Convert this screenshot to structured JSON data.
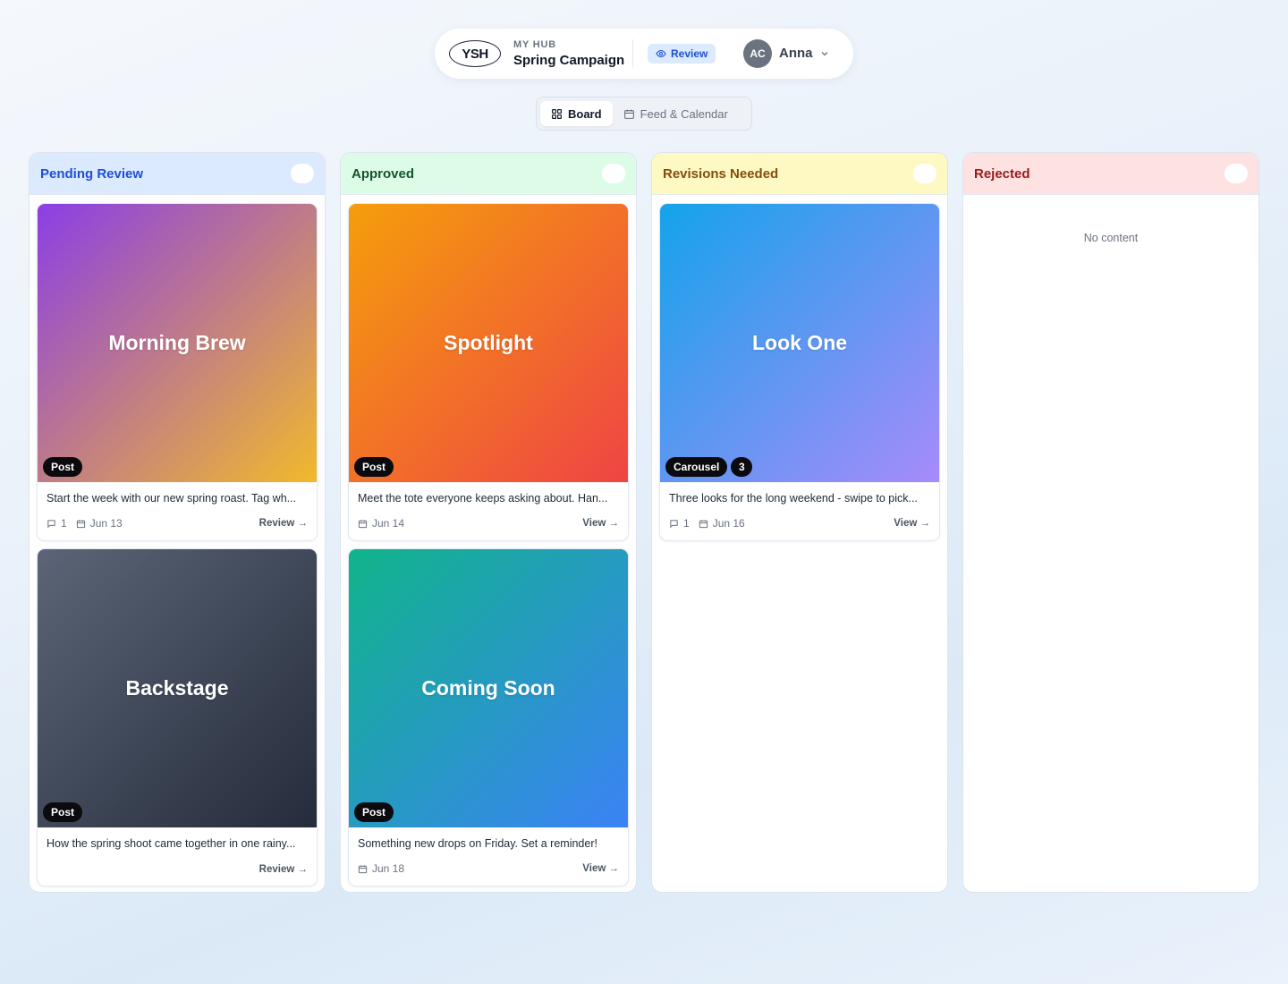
{
  "header": {
    "logo_text": "YSH",
    "hub_label": "MY HUB",
    "campaign_title": "Spring Campaign",
    "mode_badge": "Review",
    "user_initials": "AC",
    "user_name": "Anna"
  },
  "view_toggle": {
    "board_label": "Board",
    "feed_label": "Feed & Calendar",
    "active": "Board"
  },
  "columns": [
    {
      "title": "Pending Review",
      "color": "#1d4ed8",
      "head_bg": "#dbeafe",
      "cards": [
        {
          "title": "Morning Brew",
          "gradient": [
            "#8b3ee6",
            "#f2b92c"
          ],
          "badge": "Post",
          "caption": "Start the week with our new spring roast. Tag wh...",
          "comments": "1",
          "date": "Jun 13",
          "action": "Review →"
        },
        {
          "title": "Backstage",
          "gradient": [
            "#5b6577",
            "#252c3b"
          ],
          "badge": "Post",
          "caption": "How the spring shoot came together in one rainy...",
          "action": "Review →"
        }
      ]
    },
    {
      "title": "Approved",
      "color": "#14532d",
      "head_bg": "#dcfce7",
      "cards": [
        {
          "title": "Spotlight",
          "gradient": [
            "#f59e0b",
            "#ef4444"
          ],
          "badge": "Post",
          "caption": "Meet the tote everyone keeps asking about. Han...",
          "date": "Jun 14",
          "action": "View →"
        },
        {
          "title": "Coming Soon",
          "gradient": [
            "#10b48a",
            "#3b82f6"
          ],
          "badge": "Post",
          "caption": "Something new drops on Friday. Set a reminder!",
          "date": "Jun 18",
          "action": "View →"
        }
      ]
    },
    {
      "title": "Revisions Needed",
      "color": "#854d0e",
      "head_bg": "#fef9c3",
      "cards": [
        {
          "title": "Look One",
          "gradient": [
            "#14a3ea",
            "#a78bfa"
          ],
          "badge": "Carousel",
          "badge_count": "3",
          "caption": "Three looks for the long weekend - swipe to pick...",
          "comments": "1",
          "date": "Jun 16",
          "action": "View →"
        }
      ]
    },
    {
      "title": "Rejected",
      "color": "#991b1b",
      "head_bg": "#fee2e2",
      "empty_text": "No content",
      "cards": []
    }
  ],
  "icons": {
    "review": "eye-icon",
    "chevron": "chevron-down-icon",
    "board": "grid-icon",
    "feed": "calendar-icon",
    "comment": "comment-icon",
    "date": "calendar-icon"
  }
}
